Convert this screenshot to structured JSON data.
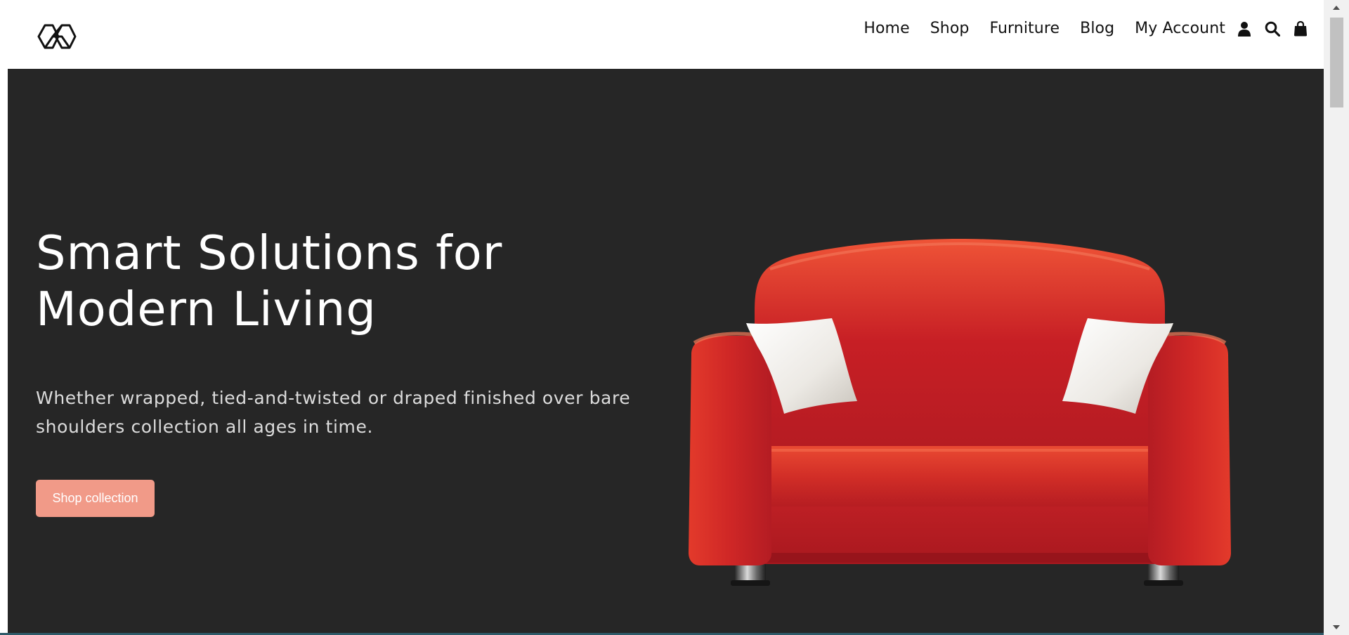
{
  "header": {
    "logo_icon": "hexagon-cubes-logo-icon",
    "nav": [
      {
        "label": "Home"
      },
      {
        "label": "Shop"
      },
      {
        "label": "Furniture"
      },
      {
        "label": "Blog"
      },
      {
        "label": "My Account"
      }
    ],
    "icons": [
      "user-icon",
      "search-icon",
      "shopping-bag-icon"
    ]
  },
  "hero": {
    "title_line1": "Smart Solutions for",
    "title_line2": "Modern Living",
    "subtitle": "Whether wrapped, tied-and-twisted or draped finished over bare shoulders collection all ages in time.",
    "button_label": "Shop collection",
    "image": "red-sofa-with-white-pillows"
  },
  "colors": {
    "hero_background": "#262626",
    "button": "#f19a88",
    "sofa": "#d72d27"
  }
}
